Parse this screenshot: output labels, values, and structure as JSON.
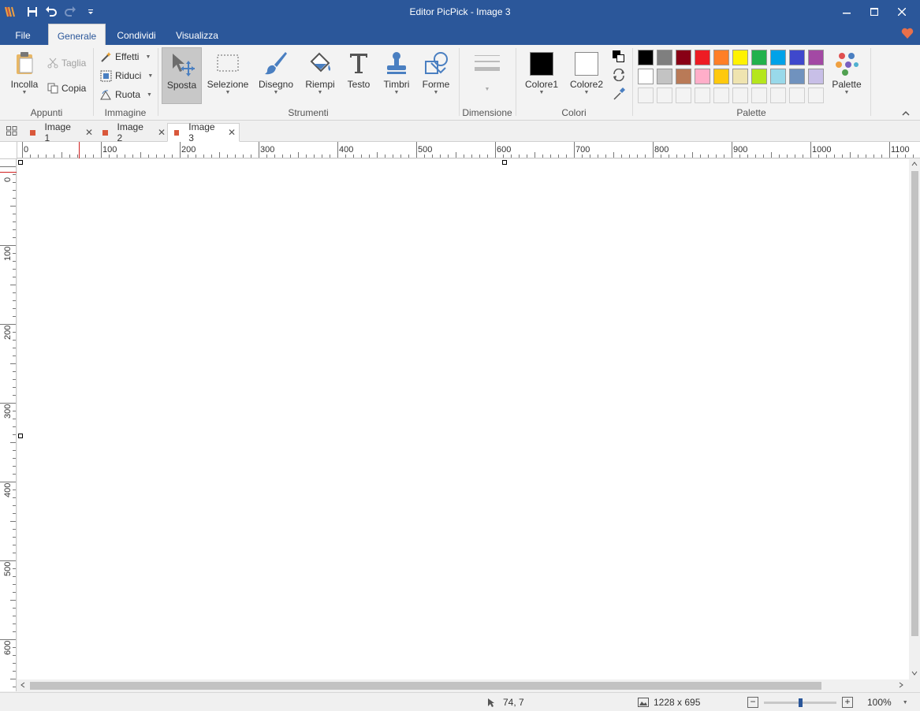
{
  "window": {
    "title": "Editor PicPick - Image 3",
    "accent": "#2b579a"
  },
  "quick_access": [
    "app-logo-icon",
    "save-icon",
    "undo-icon",
    "redo-icon",
    "customize-icon"
  ],
  "menu_tabs": [
    "File",
    "Generale",
    "Condividi",
    "Visualizza"
  ],
  "ribbon": {
    "appunti": {
      "label": "Appunti",
      "paste": "Incolla",
      "cut": "Taglia",
      "copy": "Copia"
    },
    "immagine": {
      "label": "Immagine",
      "effects": "Effetti",
      "resize": "Riduci",
      "rotate": "Ruota"
    },
    "strumenti": {
      "label": "Strumenti",
      "move": "Sposta",
      "selection": "Selezione",
      "draw": "Disegno",
      "fill": "Riempi",
      "text": "Testo",
      "stamps": "Timbri",
      "shapes": "Forme"
    },
    "dimensione": {
      "label": "Dimensione"
    },
    "colori": {
      "label": "Colori",
      "color1": "Colore1",
      "color2": "Colore2"
    },
    "palette": {
      "label": "Palette",
      "button": "Palette",
      "row1": [
        "#000000",
        "#7f7f7f",
        "#880015",
        "#ed1c24",
        "#ff7f27",
        "#fff200",
        "#22b14c",
        "#00a2e8",
        "#3f48cc",
        "#a349a4"
      ],
      "row2": [
        "#ffffff",
        "#c3c3c3",
        "#b97a57",
        "#ffaec9",
        "#ffc90e",
        "#efe4b0",
        "#b5e61d",
        "#99d9ea",
        "#7092be",
        "#c8bfe7"
      ]
    }
  },
  "doc_tabs": [
    "Image 1",
    "Image 2",
    "Image 3"
  ],
  "ruler": {
    "h": [
      "0",
      "100",
      "200",
      "300",
      "400",
      "500",
      "600",
      "700",
      "800",
      "900",
      "1000",
      "1100"
    ],
    "v": [
      "0",
      "100",
      "200",
      "300",
      "400",
      "500",
      "600"
    ]
  },
  "status": {
    "cursor": "74, 7",
    "size": "1228 x 695",
    "zoom": "100%",
    "zoom_level": 0.5
  }
}
